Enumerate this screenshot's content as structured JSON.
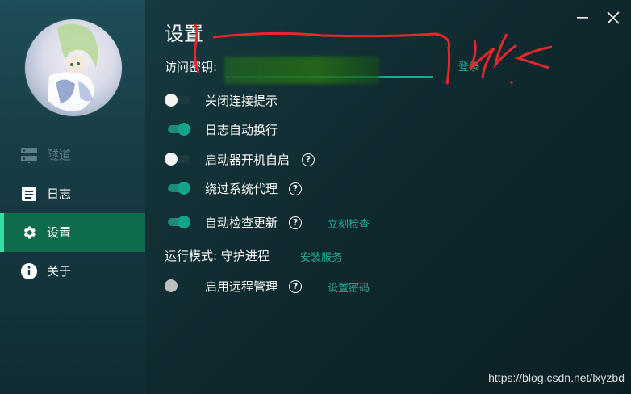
{
  "sidebar": {
    "items": [
      {
        "label": "隧道",
        "icon": "server-icon",
        "state": "disabled"
      },
      {
        "label": "日志",
        "icon": "log-document-icon",
        "state": "normal"
      },
      {
        "label": "设置",
        "icon": "gear-icon",
        "state": "active"
      },
      {
        "label": "关于",
        "icon": "info-icon",
        "state": "normal"
      }
    ]
  },
  "window": {
    "minimize_icon": "minimize-icon",
    "close_icon": "close-icon"
  },
  "settings": {
    "title": "设置",
    "access_key": {
      "label": "访问密钥:",
      "login_link": "登录"
    },
    "options": [
      {
        "label": "关闭连接提示",
        "enabled": false
      },
      {
        "label": "日志自动换行",
        "enabled": true
      },
      {
        "label": "启动器开机自启",
        "enabled": false,
        "help": "?"
      },
      {
        "label": "绕过系统代理",
        "enabled": true,
        "help": "?"
      },
      {
        "label": "自动检查更新",
        "enabled": true,
        "help": "?",
        "link": "立刻检查"
      }
    ],
    "run_mode": {
      "label": "运行模式: 守护进程",
      "link": "安装服务"
    },
    "remote": {
      "label": "启用远程管理",
      "enabled": false,
      "help": "?",
      "link": "设置密码"
    }
  },
  "colors": {
    "accent": "#1fb094",
    "active_nav": "#0e6b4b",
    "annotation": "#e8262b"
  },
  "watermark": "https://blog.csdn.net/lxyzbd"
}
